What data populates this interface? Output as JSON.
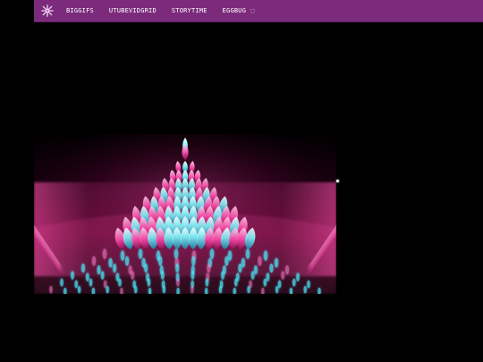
{
  "navbar": {
    "logo_icon": "sparkle-flower-logo-icon",
    "items": [
      {
        "label": "BIGGIFS"
      },
      {
        "label": "UTUBEVIDGRID"
      },
      {
        "label": "STORYTIME"
      },
      {
        "label": "EGGBUG"
      }
    ],
    "extra_icon": "tiny-box-icon"
  },
  "artwork": {
    "kind": "fractal-lotus-image",
    "colors": {
      "accent_pink": "#ff4fae",
      "accent_cyan": "#46f0ff",
      "navbar_purple": "#7b2a7c"
    }
  }
}
